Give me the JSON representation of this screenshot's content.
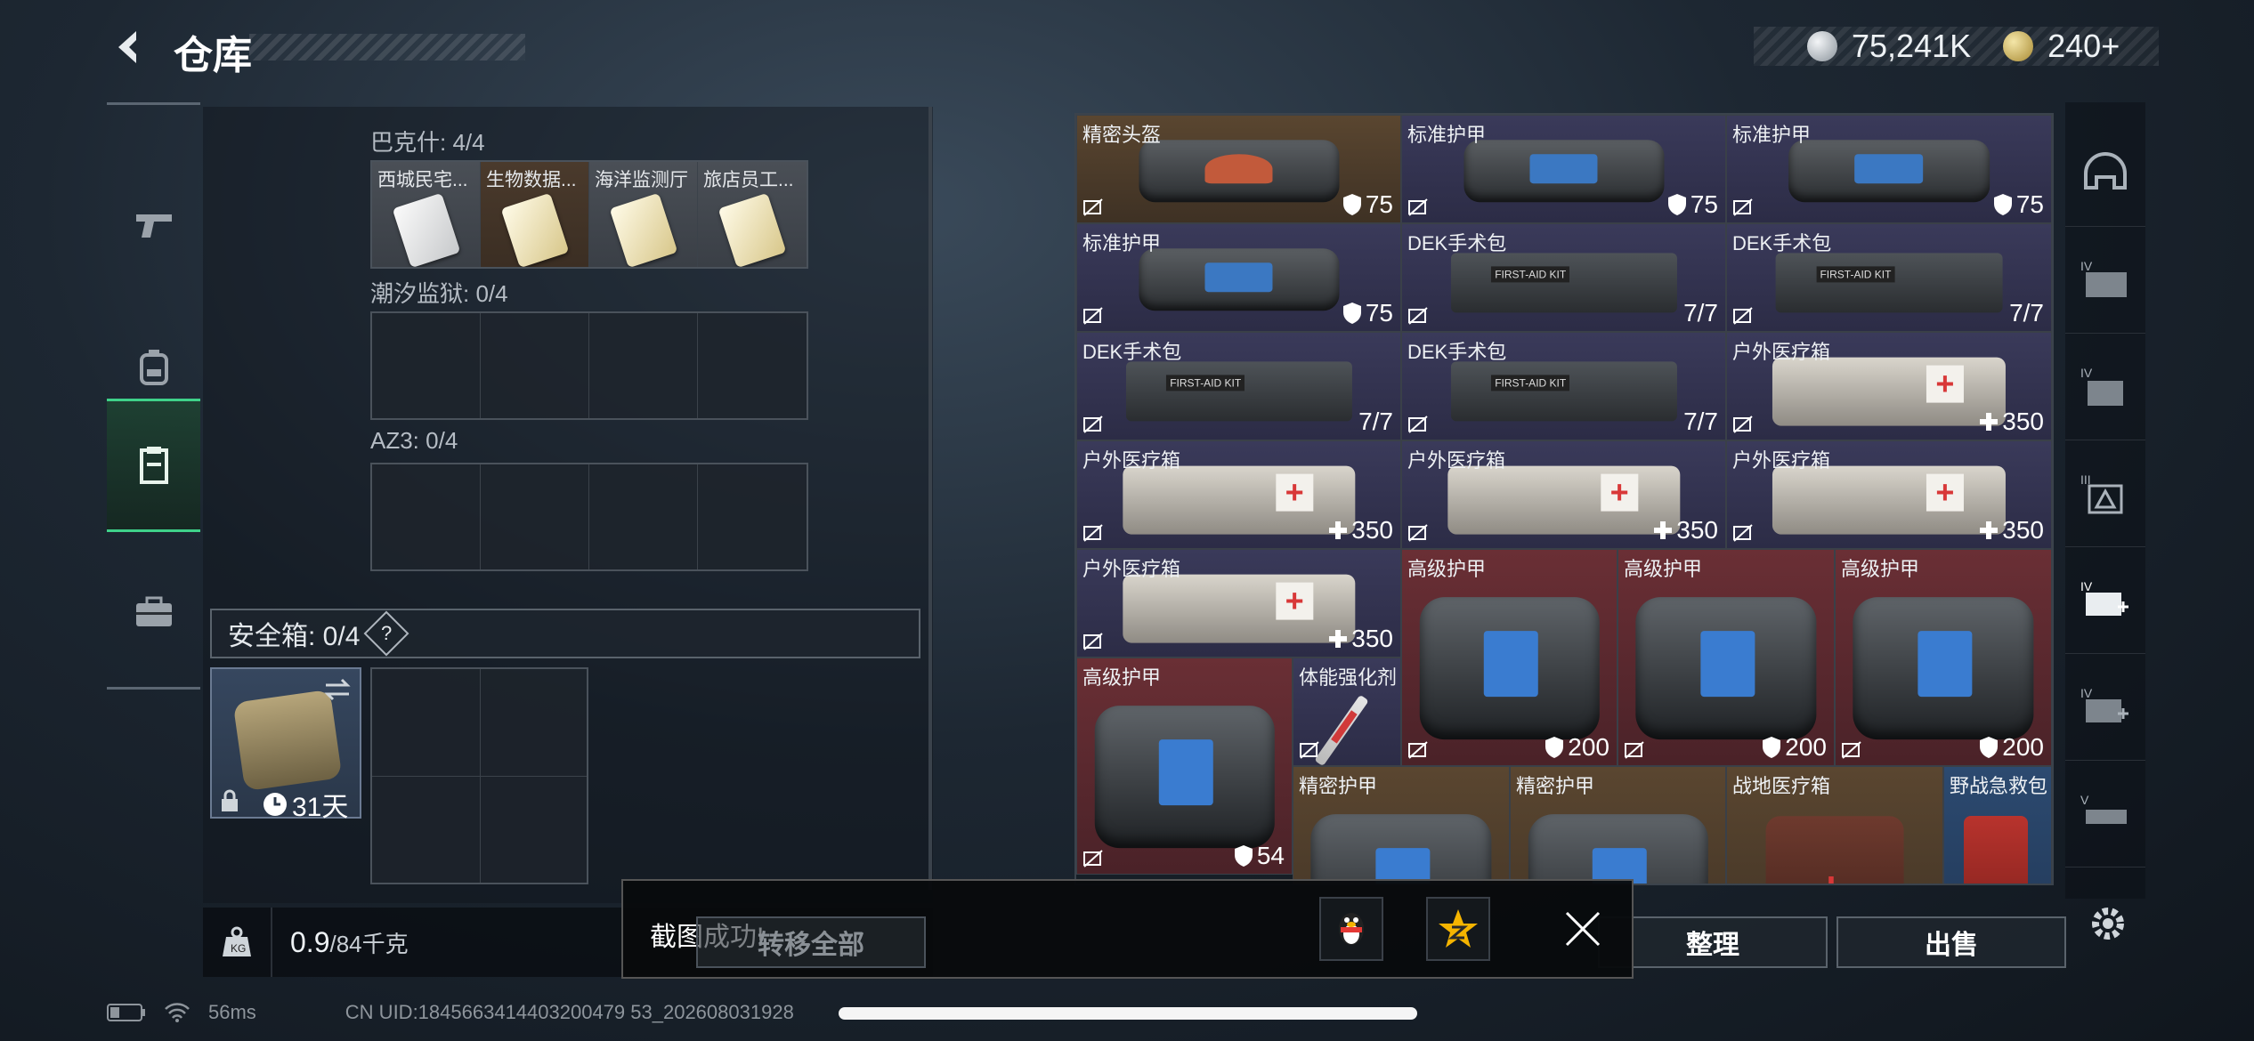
{
  "header": {
    "title": "仓库",
    "currency_silver": "75,241K",
    "currency_gold": "240+"
  },
  "left": {
    "sections": [
      {
        "label": "巴克什: 4/4",
        "slots": [
          {
            "name": "西城民宅...",
            "bg": "white"
          },
          {
            "name": "生物数据...",
            "bg": "brown"
          },
          {
            "name": "海洋监测厅",
            "bg": "white"
          },
          {
            "name": "旅店员工...",
            "bg": "white"
          }
        ]
      },
      {
        "label": "潮汐监狱: 0/4"
      },
      {
        "label": "AZ3: 0/4"
      }
    ],
    "safebox": {
      "label": "安全箱: 0/4",
      "help": "?",
      "days": "31天"
    },
    "weight": {
      "current": "0.9",
      "max": "/84千克"
    }
  },
  "grid": {
    "items": [
      {
        "name": "精密头盔",
        "value": "75",
        "icon": "shield-icon",
        "bg": "gold",
        "img": "helmet"
      },
      {
        "name": "标准护甲",
        "value": "75",
        "icon": "shield-icon",
        "bg": "purple",
        "img": "bag"
      },
      {
        "name": "标准护甲",
        "value": "75",
        "icon": "shield-icon",
        "bg": "purple",
        "img": "bag"
      },
      {
        "name": "标准护甲",
        "value": "75",
        "icon": "shield-icon",
        "bg": "purple",
        "img": "bag"
      },
      {
        "name": "DEK手术包",
        "value": "7/7",
        "icon": "",
        "bg": "purple",
        "img": "kit"
      },
      {
        "name": "DEK手术包",
        "value": "7/7",
        "icon": "",
        "bg": "purple",
        "img": "kit"
      },
      {
        "name": "DEK手术包",
        "value": "7/7",
        "icon": "",
        "bg": "purple",
        "img": "kit"
      },
      {
        "name": "DEK手术包",
        "value": "7/7",
        "icon": "",
        "bg": "purple",
        "img": "kit"
      },
      {
        "name": "户外医疗箱",
        "value": "350",
        "icon": "plus-icon",
        "bg": "purple",
        "img": "med"
      },
      {
        "name": "户外医疗箱",
        "value": "350",
        "icon": "plus-icon",
        "bg": "purple",
        "img": "med"
      },
      {
        "name": "户外医疗箱",
        "value": "350",
        "icon": "plus-icon",
        "bg": "purple",
        "img": "med"
      },
      {
        "name": "户外医疗箱",
        "value": "350",
        "icon": "plus-icon",
        "bg": "purple",
        "img": "med"
      },
      {
        "name": "户外医疗箱",
        "value": "350",
        "icon": "plus-icon",
        "bg": "purple",
        "img": "med"
      },
      {
        "name": "高级护甲",
        "value": "200",
        "icon": "shield-icon",
        "bg": "red",
        "img": "big"
      },
      {
        "name": "高级护甲",
        "value": "200",
        "icon": "shield-icon",
        "bg": "red",
        "img": "big"
      },
      {
        "name": "高级护甲",
        "value": "200",
        "icon": "shield-icon",
        "bg": "red",
        "img": "big"
      },
      {
        "name": "高级护甲",
        "value": "54",
        "icon": "shield-icon",
        "bg": "red",
        "img": "big"
      },
      {
        "name": "体能强化剂",
        "value": "",
        "icon": "",
        "bg": "purple",
        "img": "syringe"
      },
      {
        "name": "精密护甲",
        "value": "",
        "icon": "",
        "bg": "gold",
        "img": "big"
      },
      {
        "name": "精密护甲",
        "value": "",
        "icon": "",
        "bg": "gold",
        "img": "big"
      },
      {
        "name": "战地医疗箱",
        "value": "",
        "icon": "",
        "bg": "gold",
        "img": "red"
      },
      {
        "name": "野战急救包",
        "value": "",
        "icon": "",
        "bg": "blue",
        "img": "redbox"
      }
    ]
  },
  "buttons": {
    "sort": "整理",
    "sell": "出售",
    "transfer_all": "转移全部"
  },
  "toast": {
    "text": "截图成功!"
  },
  "status": {
    "ping": "56ms",
    "uid": "CN UID:1845663414403200479 53_202608031928"
  }
}
